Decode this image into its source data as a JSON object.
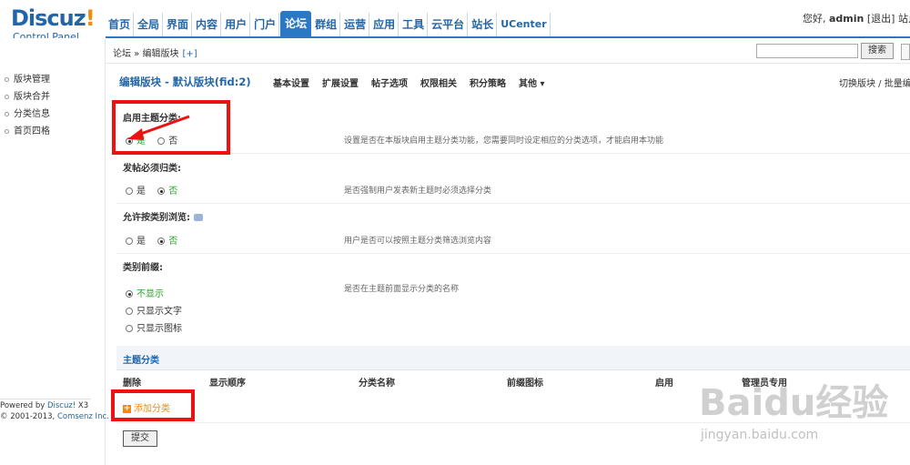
{
  "logo": {
    "brand": "Discuz",
    "bang": "!",
    "sub": "Control Panel"
  },
  "nav": {
    "items": [
      "首页",
      "全局",
      "界面",
      "内容",
      "用户",
      "门户",
      "论坛",
      "群组",
      "运营",
      "应用",
      "工具",
      "云平台",
      "站长",
      "UCenter"
    ],
    "active_index": 6
  },
  "user_info": {
    "greeting": "您好,",
    "name": "admin",
    "logout": "[退出]",
    "site": "站点"
  },
  "sidebar": {
    "items": [
      "版块管理",
      "版块合并",
      "分类信息",
      "首页四格"
    ],
    "powered_prefix": "Powered by ",
    "powered_brand": "Discuz!",
    "powered_version": " X3",
    "copyright_prefix": "© 2001-2013, ",
    "copyright_brand": "Comsenz Inc."
  },
  "breadcrumb": {
    "path": "论坛 » 编辑版块",
    "plus": "[+]"
  },
  "search": {
    "button": "搜索"
  },
  "subnav": {
    "title": "编辑版块 - 默认版块(fid:2)",
    "tabs": [
      "基本设置",
      "扩展设置",
      "帖子选项",
      "权限相关",
      "积分策略",
      "其他 ▾"
    ],
    "right": "切换版块 / 批量编辑"
  },
  "fields": [
    {
      "title": "启用主题分类:",
      "options": [
        "是",
        "否"
      ],
      "selected": 0,
      "desc": "设置是否在本版块启用主题分类功能，您需要同时设定相应的分类选项，才能启用本功能"
    },
    {
      "title": "发帖必须归类:",
      "options": [
        "是",
        "否"
      ],
      "selected": 1,
      "desc": "是否强制用户发表新主题时必须选择分类"
    },
    {
      "title": "允许按类别浏览:",
      "options": [
        "是",
        "否"
      ],
      "selected": 1,
      "desc": "用户是否可以按照主题分类筛选浏览内容"
    },
    {
      "title": "类别前缀:",
      "options": [
        "不显示",
        "只显示文字",
        "只显示图标"
      ],
      "selected": 0,
      "desc": "是否在主题前面显示分类的名称"
    }
  ],
  "section": {
    "title": "主题分类"
  },
  "table": {
    "headers": [
      "删除",
      "显示顺序",
      "分类名称",
      "前缀图标",
      "启用",
      "管理员专用"
    ]
  },
  "add_category": "添加分类",
  "submit": "提交",
  "watermark": {
    "text": "Baidu经验",
    "url": "jingyan.baidu.com"
  },
  "colors": {
    "accent": "#2B78C5",
    "highlight": "#EE1111",
    "green": "#29A329",
    "orange": "#F28C0F"
  }
}
